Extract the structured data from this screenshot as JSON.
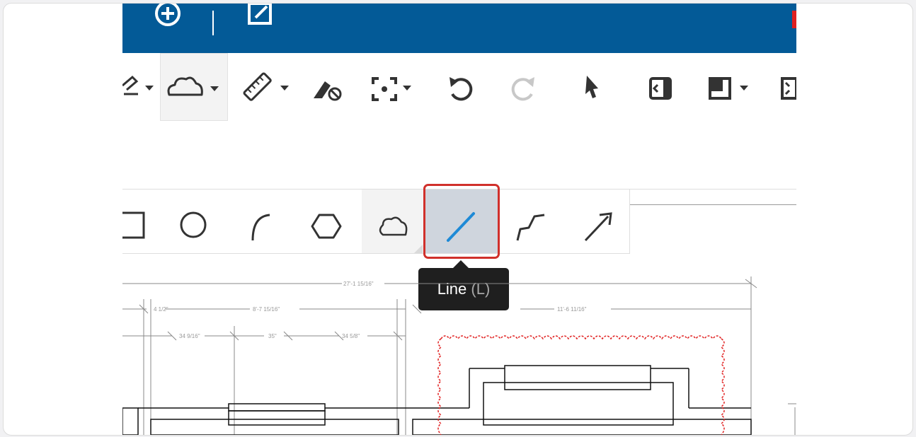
{
  "colors": {
    "brand_blue": "#035a97",
    "accent_blue": "#1e8ad6",
    "highlight_red": "#d0302b",
    "tooltip_bg": "#1f1f1f",
    "markup_red": "#e02020"
  },
  "topbar": {
    "icons": [
      "plus-circle-icon",
      "edit-square-icon"
    ]
  },
  "toolbar": {
    "tools": [
      {
        "name": "pen-tool",
        "icon": "pen-icon"
      },
      {
        "name": "cloud-tool",
        "icon": "cloud-icon",
        "active": true
      },
      {
        "name": "measure-tool",
        "icon": "ruler-icon"
      },
      {
        "name": "eraser-tool",
        "icon": "eraser-icon"
      },
      {
        "name": "focus-tool",
        "icon": "focus-frame-icon"
      },
      {
        "name": "undo-button",
        "icon": "undo-icon"
      },
      {
        "name": "redo-button",
        "icon": "redo-icon",
        "disabled": true
      },
      {
        "name": "select-tool",
        "icon": "pointer-icon"
      },
      {
        "name": "panel-toggle",
        "icon": "panel-left-icon"
      },
      {
        "name": "layout-tool",
        "icon": "layout-icon"
      },
      {
        "name": "fullscreen-button",
        "icon": "collapse-icon"
      }
    ]
  },
  "shape_tools": [
    {
      "name": "rectangle",
      "icon": "rectangle-icon"
    },
    {
      "name": "ellipse",
      "icon": "circle-icon"
    },
    {
      "name": "arc",
      "icon": "arc-icon"
    },
    {
      "name": "polygon",
      "icon": "hexagon-icon"
    },
    {
      "name": "cloud",
      "icon": "cloud-icon"
    },
    {
      "name": "line",
      "icon": "line-icon",
      "selected": true
    },
    {
      "name": "polyline",
      "icon": "polyline-icon"
    },
    {
      "name": "arrow",
      "icon": "arrow-icon"
    }
  ],
  "tooltip": {
    "label": "Line",
    "shortcut": "(L)"
  },
  "drawing": {
    "dimensions": [
      "27'-1 15/16\"",
      "4 1/2\"",
      "8'-7 15/16\"",
      "11'-6 11/16\"",
      "34 9/16\"",
      "35\"",
      "34 5/8\""
    ]
  }
}
